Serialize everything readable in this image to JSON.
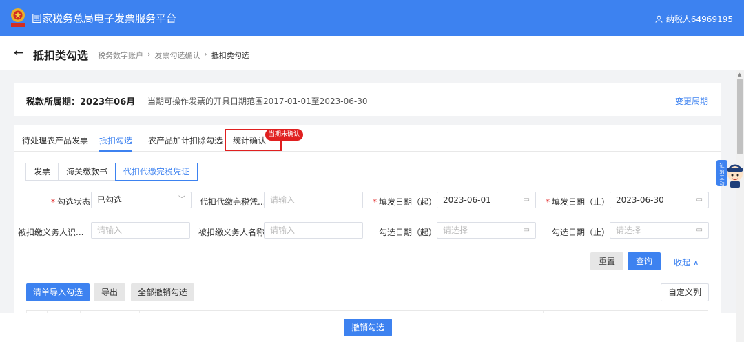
{
  "header": {
    "title": "国家税务总局电子发票服务平台",
    "user": "纳税人64969195",
    "brand_color": "#3d82f0"
  },
  "page": {
    "back_icon": "←",
    "title": "抵扣类勾选",
    "breadcrumb": [
      "税务数字账户",
      "发票勾选确认",
      "抵扣类勾选"
    ],
    "breadcrumb_sep": "›"
  },
  "period": {
    "label": "税款所属期：2023年06月",
    "range": "当期可操作发票的开具日期范围2017-01-01至2023-06-30",
    "change": "变更属期"
  },
  "tabs": {
    "items": [
      "待处理农产品发票",
      "抵扣勾选",
      "农产品加计扣除勾选",
      "统计确认"
    ],
    "active_index": 1,
    "badge": "当期未确认"
  },
  "subtabs": {
    "items": [
      "发票",
      "海关缴款书",
      "代扣代缴完税凭证"
    ],
    "active_index": 2
  },
  "filters": {
    "status": {
      "label": "勾选状态",
      "required": true,
      "value": "已勾选",
      "icon": "chevron-down-icon"
    },
    "voucher": {
      "label": "代扣代缴完税凭...",
      "placeholder": "请输入"
    },
    "fill_start": {
      "label": "填发日期（起）",
      "required": true,
      "value": "2023-06-01",
      "icon": "calendar-icon"
    },
    "fill_end": {
      "label": "填发日期（止）",
      "required": true,
      "value": "2023-06-30",
      "icon": "calendar-icon"
    },
    "payer_id": {
      "label": "被扣缴义务人识...",
      "placeholder": "请输入"
    },
    "payer_name": {
      "label": "被扣缴义务人名称",
      "placeholder": "请输入"
    },
    "check_start": {
      "label": "勾选日期（起）",
      "placeholder": "请选择",
      "icon": "calendar-icon"
    },
    "check_end": {
      "label": "勾选日期（止）",
      "placeholder": "请选择",
      "icon": "calendar-icon"
    }
  },
  "actions": {
    "reset": "重置",
    "query": "查询",
    "collapse": "收起",
    "import": "清单导入勾选",
    "export": "导出",
    "cancel_all": "全部撤销勾选",
    "custom_columns": "自定义列",
    "cancel_selection": "撤销勾选"
  },
  "assistant": {
    "lines": [
      "征",
      "纳",
      "互",
      "动"
    ]
  }
}
